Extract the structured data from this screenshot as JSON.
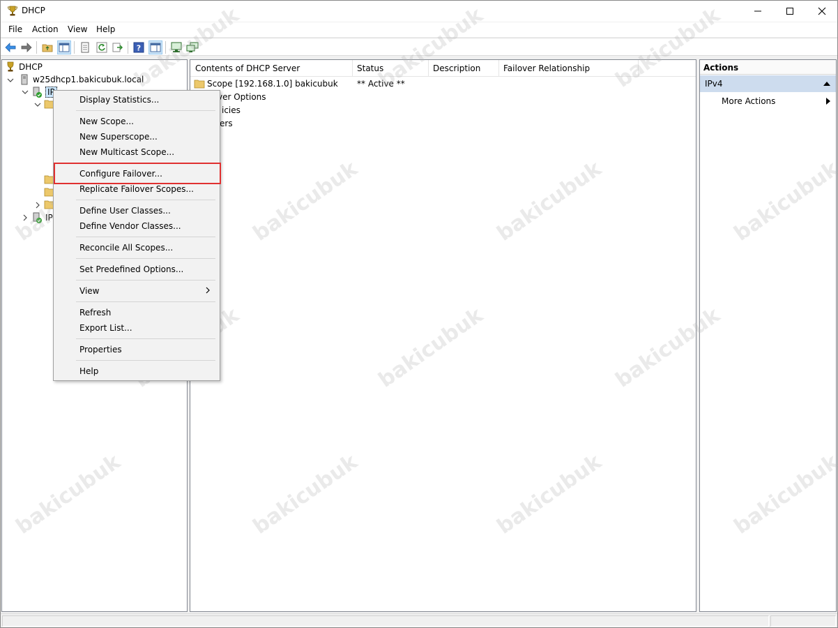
{
  "window": {
    "title": "DHCP"
  },
  "menu": [
    "File",
    "Action",
    "View",
    "Help"
  ],
  "tree": {
    "root": "DHCP",
    "server": "w25dhcp1.bakicubuk.local",
    "ipv4_partial": "IP",
    "ipv6_partial": "IP"
  },
  "list": {
    "columns": [
      "Contents of DHCP Server",
      "Status",
      "Description",
      "Failover Relationship"
    ],
    "rows": [
      {
        "name": "Scope [192.168.1.0] bakicubuk",
        "status": "** Active **"
      },
      {
        "name": "ver Options",
        "status": ""
      },
      {
        "name": "icies",
        "status": ""
      },
      {
        "name": "ers",
        "status": ""
      }
    ]
  },
  "actions": {
    "title": "Actions",
    "section": "IPv4",
    "more": "More Actions"
  },
  "context_menu": {
    "items": [
      "Display Statistics...",
      "New Scope...",
      "New Superscope...",
      "New Multicast Scope...",
      "Configure Failover...",
      "Replicate Failover Scopes...",
      "Define User Classes...",
      "Define Vendor Classes...",
      "Reconcile All Scopes...",
      "Set Predefined Options...",
      "View",
      "Refresh",
      "Export List...",
      "Properties",
      "Help"
    ],
    "highlighted": "Configure Failover...",
    "highlight_color": "#e03030"
  },
  "watermark": "bakicubuk"
}
